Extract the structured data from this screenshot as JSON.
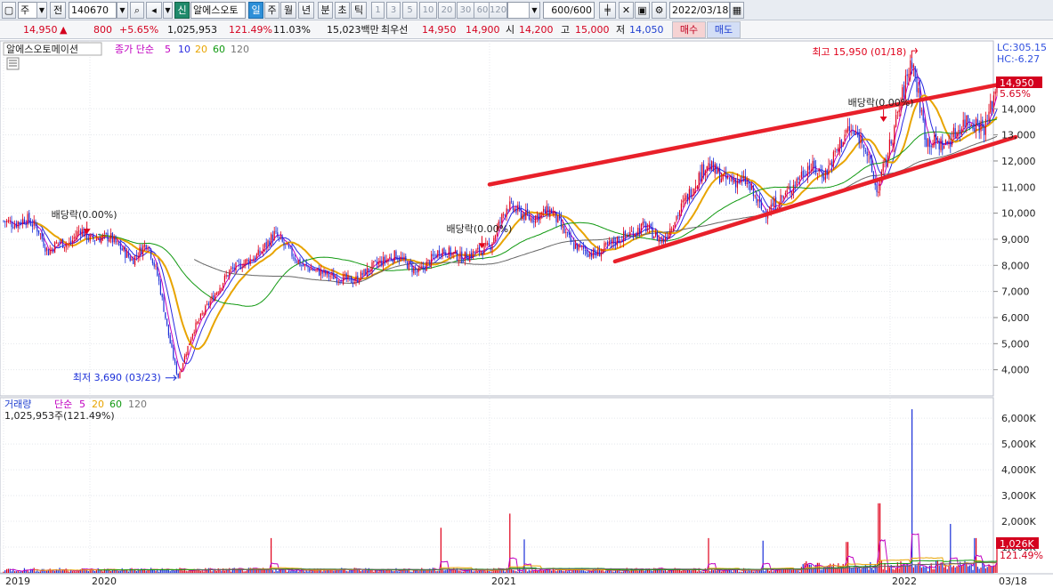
{
  "toolbar": {
    "market": "주",
    "prev": "전",
    "code": "140670",
    "stock_name": "알에스오토",
    "mode_credit": "신",
    "period_tabs": [
      "일",
      "주",
      "월",
      "년",
      "분",
      "초",
      "틱"
    ],
    "intervals": [
      "1",
      "3",
      "5",
      "10",
      "20",
      "30",
      "60",
      "120"
    ],
    "bar_count": "600/600",
    "date": "2022/03/18"
  },
  "quote": {
    "price": "14,950",
    "change": "800",
    "change_pct": "+5.65%",
    "volume": "1,025,953",
    "volume_ratio": "121.49%",
    "turnover": "11.03%",
    "amount": "15,023백만",
    "best_ask_label": "최우선",
    "best_ask": "14,950",
    "best_bid": "14,900",
    "open_label": "시",
    "open": "14,200",
    "high_label": "고",
    "high": "15,000",
    "low_label": "저",
    "low": "14,050",
    "buy": "매수",
    "sell": "매도"
  },
  "legend": {
    "name": "알에스오토메이션",
    "ma_label": "종가 단순",
    "ma": [
      "5",
      "10",
      "20",
      "60",
      "120"
    ],
    "lc": "LC:305.15",
    "hc": "HC:-6.27",
    "current_tag": "14,950",
    "current_pct": "5.65%",
    "vol_name": "거래량",
    "vol_ma_label": "단순",
    "vol_ma": [
      "5",
      "20",
      "60",
      "120"
    ],
    "vol_current": "1,025,953주(121.49%)",
    "vol_tag": "1,026K",
    "vol_pct": "121.49%"
  },
  "colors": {
    "up": "#e0001a",
    "down": "#1a2fd8",
    "ma5": "#c000c0",
    "ma10": "#2828e0",
    "ma20": "#e8a400",
    "ma60": "#119911",
    "ma120": "#666666",
    "trend": "#e8202a"
  },
  "chart_data": {
    "type": "candlestick",
    "x_range": [
      "2019-06",
      "2022-03-18"
    ],
    "x_ticks": [
      {
        "label": "2019",
        "d": "2019-06-13"
      },
      {
        "label": "2020",
        "d": "2020-01-02"
      },
      {
        "label": "2021",
        "d": "2021-01-04"
      },
      {
        "label": "2022",
        "d": "2022-01-03"
      },
      {
        "label": "03/18",
        "d": "2022-03-18"
      }
    ],
    "y_ticks": [
      4000,
      5000,
      6000,
      7000,
      8000,
      9000,
      10000,
      11000,
      12000,
      13000,
      14000
    ],
    "y_tick_labels": [
      "4,000",
      "5,000",
      "6,000",
      "7,000",
      "8,000",
      "9,000",
      "10,000",
      "11,000",
      "12,000",
      "13,000",
      "14,000"
    ],
    "price_range": [
      3000,
      16600
    ],
    "price_path": [
      [
        "2019-06-13",
        9700
      ],
      [
        "2019-07-10",
        9600
      ],
      [
        "2019-08-05",
        9800
      ],
      [
        "2019-09-02",
        9400
      ],
      [
        "2019-09-25",
        8500
      ],
      [
        "2019-10-20",
        8900
      ],
      [
        "2019-11-15",
        8800
      ],
      [
        "2019-12-10",
        9400
      ],
      [
        "2020-01-02",
        9000
      ],
      [
        "2020-01-20",
        9100
      ],
      [
        "2020-02-10",
        8200
      ],
      [
        "2020-02-24",
        8900
      ],
      [
        "2020-03-05",
        7500
      ],
      [
        "2020-03-15",
        5200
      ],
      [
        "2020-03-23",
        3690
      ],
      [
        "2020-04-06",
        5500
      ],
      [
        "2020-04-20",
        6500
      ],
      [
        "2020-05-10",
        7800
      ],
      [
        "2020-06-05",
        8400
      ],
      [
        "2020-06-20",
        9200
      ],
      [
        "2020-07-15",
        8000
      ],
      [
        "2020-08-10",
        7600
      ],
      [
        "2020-09-01",
        7400
      ],
      [
        "2020-09-20",
        8000
      ],
      [
        "2020-10-10",
        8400
      ],
      [
        "2020-10-30",
        7700
      ],
      [
        "2020-11-20",
        8600
      ],
      [
        "2020-12-10",
        8300
      ],
      [
        "2021-01-04",
        8700
      ],
      [
        "2021-01-20",
        10300
      ],
      [
        "2021-02-10",
        9800
      ],
      [
        "2021-03-01",
        10100
      ],
      [
        "2021-03-20",
        8800
      ],
      [
        "2021-04-10",
        8400
      ],
      [
        "2021-05-01",
        9000
      ],
      [
        "2021-05-25",
        9500
      ],
      [
        "2021-06-10",
        8900
      ],
      [
        "2021-07-01",
        10500
      ],
      [
        "2021-07-20",
        11900
      ],
      [
        "2021-08-05",
        11300
      ],
      [
        "2021-08-25",
        11200
      ],
      [
        "2021-09-10",
        10000
      ],
      [
        "2021-09-30",
        10700
      ],
      [
        "2021-10-20",
        11800
      ],
      [
        "2021-11-05",
        11500
      ],
      [
        "2021-11-25",
        13200
      ],
      [
        "2021-12-10",
        12800
      ],
      [
        "2021-12-22",
        10800
      ],
      [
        "2022-01-03",
        12600
      ],
      [
        "2022-01-18",
        15950
      ],
      [
        "2022-01-28",
        12800
      ],
      [
        "2022-02-10",
        12600
      ],
      [
        "2022-02-25",
        13600
      ],
      [
        "2022-03-10",
        13300
      ],
      [
        "2022-03-18",
        14950
      ]
    ],
    "trendlines": [
      {
        "from": [
          "2021-01-04",
          11100
        ],
        "to": [
          "2022-03-24",
          14980
        ]
      },
      {
        "from": [
          "2021-04-28",
          8150
        ],
        "to": [
          "2022-03-31",
          12920
        ]
      }
    ],
    "annotations": [
      {
        "text": "최고 15,950 (01/18)",
        "d": "2022-01-18",
        "v": 15950,
        "kind": "high"
      },
      {
        "text": "최저 3,690 (03/23)",
        "d": "2020-03-23",
        "v": 3690,
        "kind": "low"
      },
      {
        "text": "배당락(0.00%)",
        "d": "2019-12-26",
        "v": 9200,
        "kind": "div"
      },
      {
        "text": "배당락(0.00%)",
        "d": "2020-12-28",
        "v": 8650,
        "kind": "div"
      },
      {
        "text": "배당락(0.00%)",
        "d": "2021-12-28",
        "v": 13500,
        "kind": "div"
      }
    ],
    "volume_y_ticks": [
      1000000,
      2000000,
      3000000,
      4000000,
      5000000,
      6000000
    ],
    "volume_y_tick_labels": [
      "1,000K",
      "2,000K",
      "3,000K",
      "4,000K",
      "5,000K",
      "6,000K"
    ],
    "volume_range": [
      0,
      6800000
    ],
    "volume_spikes": [
      [
        "2020-06-17",
        1350000
      ],
      [
        "2020-11-20",
        1750000
      ],
      [
        "2021-01-22",
        2300000
      ],
      [
        "2021-02-05",
        1300000
      ],
      [
        "2021-07-22",
        1350000
      ],
      [
        "2021-09-10",
        1250000
      ],
      [
        "2021-11-25",
        1200000
      ],
      [
        "2021-12-24",
        2700000
      ],
      [
        "2022-01-18",
        6350000
      ],
      [
        "2022-02-14",
        1900000
      ],
      [
        "2022-03-03",
        1350000
      ],
      [
        "2022-03-18",
        1026000
      ]
    ]
  }
}
